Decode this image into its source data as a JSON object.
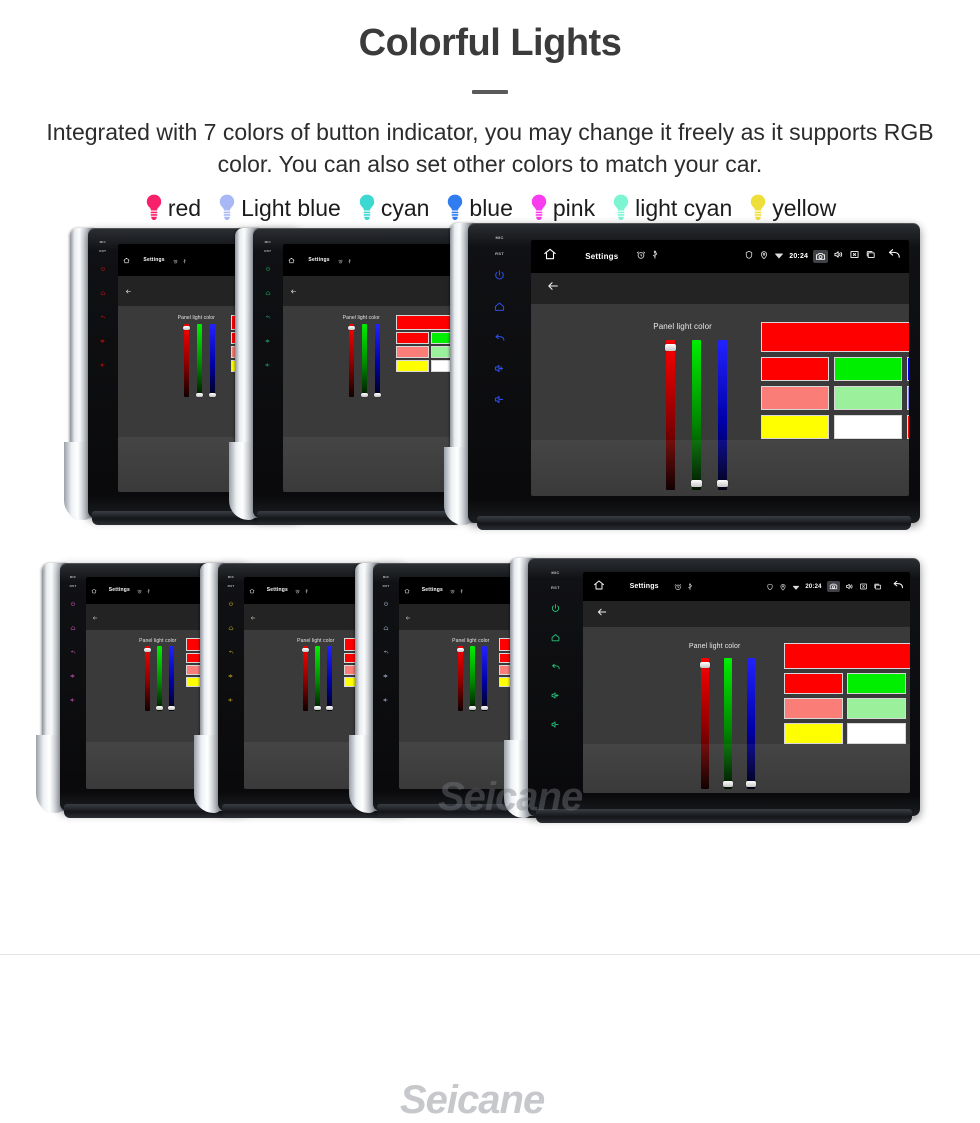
{
  "header": {
    "title": "Colorful Lights",
    "subtitle": "Integrated with 7 colors of button indicator, you may change it freely as it supports RGB color. You can also set other colors to match your car."
  },
  "legend": {
    "bulbs": [
      {
        "label": "red",
        "color": "#f8206a",
        "icon": "bulb-icon"
      },
      {
        "label": "Light blue",
        "color": "#a7b8f5",
        "icon": "bulb-icon"
      },
      {
        "label": "cyan",
        "color": "#3ed8d2",
        "icon": "bulb-icon"
      },
      {
        "label": "blue",
        "color": "#2f7df0",
        "icon": "bulb-icon"
      },
      {
        "label": "pink",
        "color": "#f93ced",
        "icon": "bulb-icon"
      },
      {
        "label": "light cyan",
        "color": "#7df4d2",
        "icon": "bulb-icon"
      },
      {
        "label": "yellow",
        "color": "#eede3a",
        "icon": "bulb-icon"
      }
    ]
  },
  "device": {
    "status_bar": {
      "home_icon": "home-icon",
      "title": "Settings",
      "alarm_icon": "alarm-icon",
      "usb_icon": "usb-icon",
      "shield_icon": "shield-icon",
      "location_icon": "location-icon",
      "wifi_icon": "wifi-icon",
      "time": "20:24",
      "camera_icon": "camera-icon",
      "volume_icon": "volume-icon",
      "close_icon": "close-box-icon",
      "recents_icon": "recents-icon",
      "back_icon": "back-arrow-icon"
    },
    "action_bar": {
      "back_icon": "back-arrow-icon"
    },
    "sidebar": {
      "mic_label": "MIC",
      "rst_label": "RST",
      "buttons": [
        "power-icon",
        "home-icon",
        "back-icon",
        "volume-up-icon",
        "volume-down-icon"
      ]
    },
    "panel": {
      "label": "Panel light color",
      "sliders": [
        {
          "name": "red-slider",
          "value": 97
        },
        {
          "name": "green-slider",
          "value": 2
        },
        {
          "name": "blue-slider",
          "value": 2
        }
      ],
      "preview_color": "#ff0000",
      "swatches": [
        [
          "#ff0000",
          "#00ee00",
          "#0000ee"
        ],
        [
          "#fa7d78",
          "#9bf09b",
          "#8a8af4"
        ],
        [
          "#ffff00",
          "#ffffff",
          "rainbow"
        ]
      ]
    }
  },
  "watermark": {
    "text": "Seicane"
  },
  "units": {
    "top_row": [
      {
        "name": "head-unit-red",
        "indicator_color": "#e01010"
      },
      {
        "name": "head-unit-green",
        "indicator_color": "#12c36a"
      },
      {
        "name": "head-unit-blue",
        "indicator_color": "#2b4ff0"
      }
    ],
    "bottom_row": [
      {
        "name": "head-unit-pink",
        "indicator_color": "#e65ad0"
      },
      {
        "name": "head-unit-yellow",
        "indicator_color": "#d6b320"
      },
      {
        "name": "head-unit-light-blue",
        "indicator_color": "#b9cbe6"
      },
      {
        "name": "head-unit-cyan",
        "indicator_color": "#25c47c"
      }
    ]
  }
}
